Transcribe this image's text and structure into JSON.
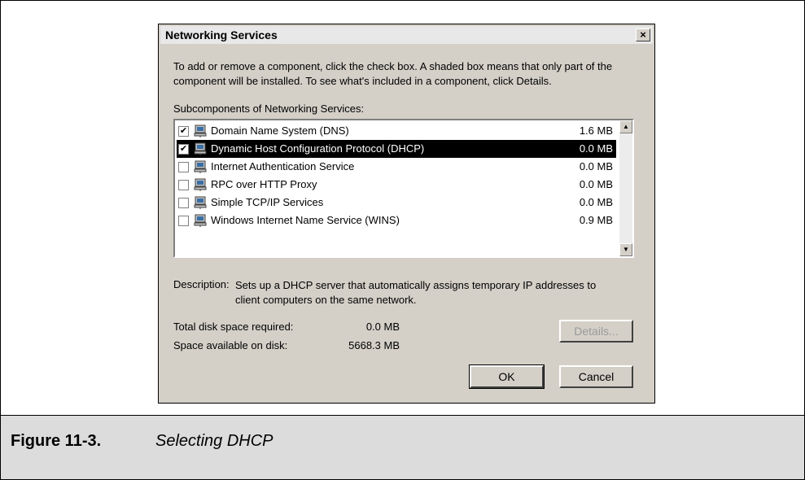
{
  "dialog": {
    "title": "Networking Services",
    "close_label": "×",
    "intro": "To add or remove a component, click the check box. A shaded box means that only part of the component will be installed. To see what's included in a component, click Details.",
    "subcomponents_label": "Subcomponents of Networking Services:",
    "components": [
      {
        "name": "Domain Name System (DNS)",
        "size": "1.6 MB",
        "checked": true,
        "selected": false
      },
      {
        "name": "Dynamic Host Configuration Protocol (DHCP)",
        "size": "0.0 MB",
        "checked": true,
        "selected": true
      },
      {
        "name": "Internet Authentication Service",
        "size": "0.0 MB",
        "checked": false,
        "selected": false
      },
      {
        "name": "RPC over HTTP Proxy",
        "size": "0.0 MB",
        "checked": false,
        "selected": false
      },
      {
        "name": "Simple TCP/IP Services",
        "size": "0.0 MB",
        "checked": false,
        "selected": false
      },
      {
        "name": "Windows Internet Name Service (WINS)",
        "size": "0.9 MB",
        "checked": false,
        "selected": false
      }
    ],
    "description_label": "Description:",
    "description": "Sets up a DHCP server that automatically assigns temporary IP addresses to client computers on the same network.",
    "total_label": "Total disk space required:",
    "total_value": "0.0 MB",
    "available_label": "Space available on disk:",
    "available_value": "5668.3 MB",
    "details_button": "Details...",
    "ok_button": "OK",
    "cancel_button": "Cancel"
  },
  "caption": {
    "figure_number": "Figure 11-3.",
    "figure_text": "Selecting DHCP"
  },
  "icons": {
    "component_icon": "network-computer-icon",
    "scroll_up_icon": "arrow-up-icon",
    "scroll_down_icon": "arrow-down-icon",
    "check_glyph": "✔"
  },
  "colors": {
    "dialog_bg": "#d4d0c8",
    "selection_bg": "#000000",
    "caption_band": "#dcdcdc"
  }
}
